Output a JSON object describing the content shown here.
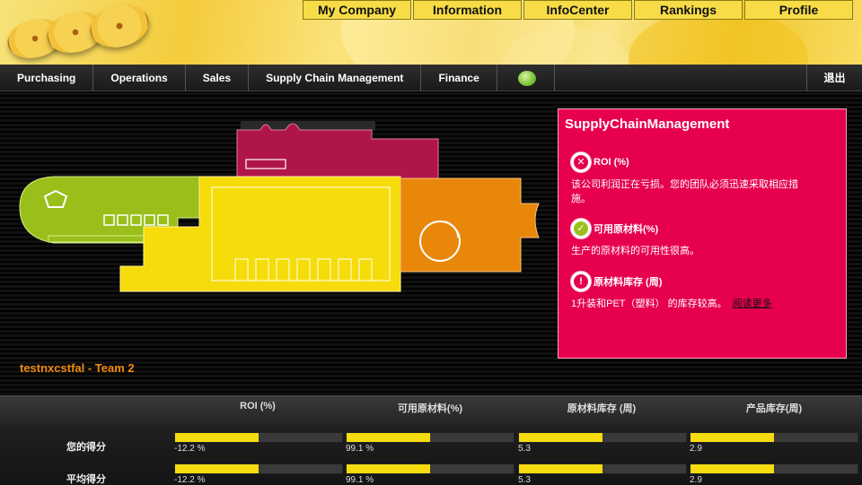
{
  "top_nav": [
    "My Company",
    "Information",
    "InfoCenter",
    "Rankings",
    "Profile"
  ],
  "main_nav": {
    "items": [
      "Purchasing",
      "Operations",
      "Sales",
      "Supply Chain Management",
      "Finance"
    ],
    "logout": "退出"
  },
  "team": "testnxcstfal - Team 2",
  "panel": {
    "title": "SupplyChainManagement",
    "kpis": [
      {
        "icon": "x-icon",
        "status_color": "#e6004d",
        "title": "ROI (%)",
        "text": "该公司利润正在亏损。您的团队必须迅速采取相应措施。"
      },
      {
        "icon": "check-icon",
        "status_color": "#9bbf1a",
        "title": "可用原材料(%)",
        "text": "生产的原材料的可用性很高。"
      },
      {
        "icon": "exclamation-icon",
        "status_color": "#e6004d",
        "title": "原材料库存 (周)",
        "text": "1升装和PET（塑料） 的库存较高。",
        "link": "阅读更多"
      }
    ]
  },
  "scores": {
    "columns": [
      "ROI (%)",
      "可用原材料(%)",
      "原材料库存 (周)",
      "产品库存(周)"
    ],
    "rows": [
      {
        "label": "您的得分",
        "values": [
          "-12.2 %",
          "99.1 %",
          "5.3",
          "2.9"
        ],
        "fills": [
          0.5,
          0.5,
          0.5,
          0.5
        ]
      },
      {
        "label": "平均得分",
        "values": [
          "-12.2 %",
          "99.1 %",
          "5.3",
          "2.9"
        ],
        "fills": [
          0.5,
          0.5,
          0.5,
          0.5
        ]
      }
    ]
  },
  "colors": {
    "accent": "#e6004d",
    "bar": "#f6dc0f",
    "green": "#9bbf1a",
    "orange": "#e8870a",
    "yellow": "#f5dc0a",
    "crimson": "#b0154a"
  }
}
